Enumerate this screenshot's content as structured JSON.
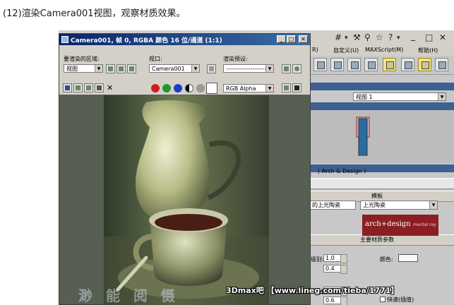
{
  "caption": "(12)渲染Camera001视图，观察材质效果。",
  "render_window": {
    "title": "Camera001, 帧 0, RGBA 颜色 16 位/通道 (1:1)",
    "area_label": "要渲染的区域:",
    "area_value": "视图",
    "viewport_label": "视口:",
    "viewport_value": "Camera001",
    "preset_label": "渲染预设:",
    "preset_value": "--------------------",
    "channel_value": "RGB Alpha",
    "close_glyph": "✕",
    "swatch_color": "#ffffff",
    "render_watermark": "渺 能 阅 慑"
  },
  "right_panel": {
    "menu": [
      "R)",
      "自定义(U)",
      "MAXScript(M)",
      "帮助(H)"
    ],
    "viewport_dropdown": "视图 1",
    "material_title": "( Arch & Design )",
    "templates_header": "模板",
    "template_list_item": "的上光陶瓷",
    "template_dropdown": "上光陶瓷",
    "arch_logo": "arch+design",
    "mental_ray_logo": "mental ray",
    "main_params_header": "主要材质参数",
    "diffuse_level_label": "级别:",
    "diffuse_level": "1.0",
    "roughness": "0.4",
    "color_label": "颜色:",
    "reflect_value_1": "1.0",
    "reflect_value_2": "0.6",
    "reflect_prefix": "反射",
    "fast_label": "快速(插值)"
  },
  "banner": "3Dmax吧 【www.lineg.com/tieba/1771】"
}
